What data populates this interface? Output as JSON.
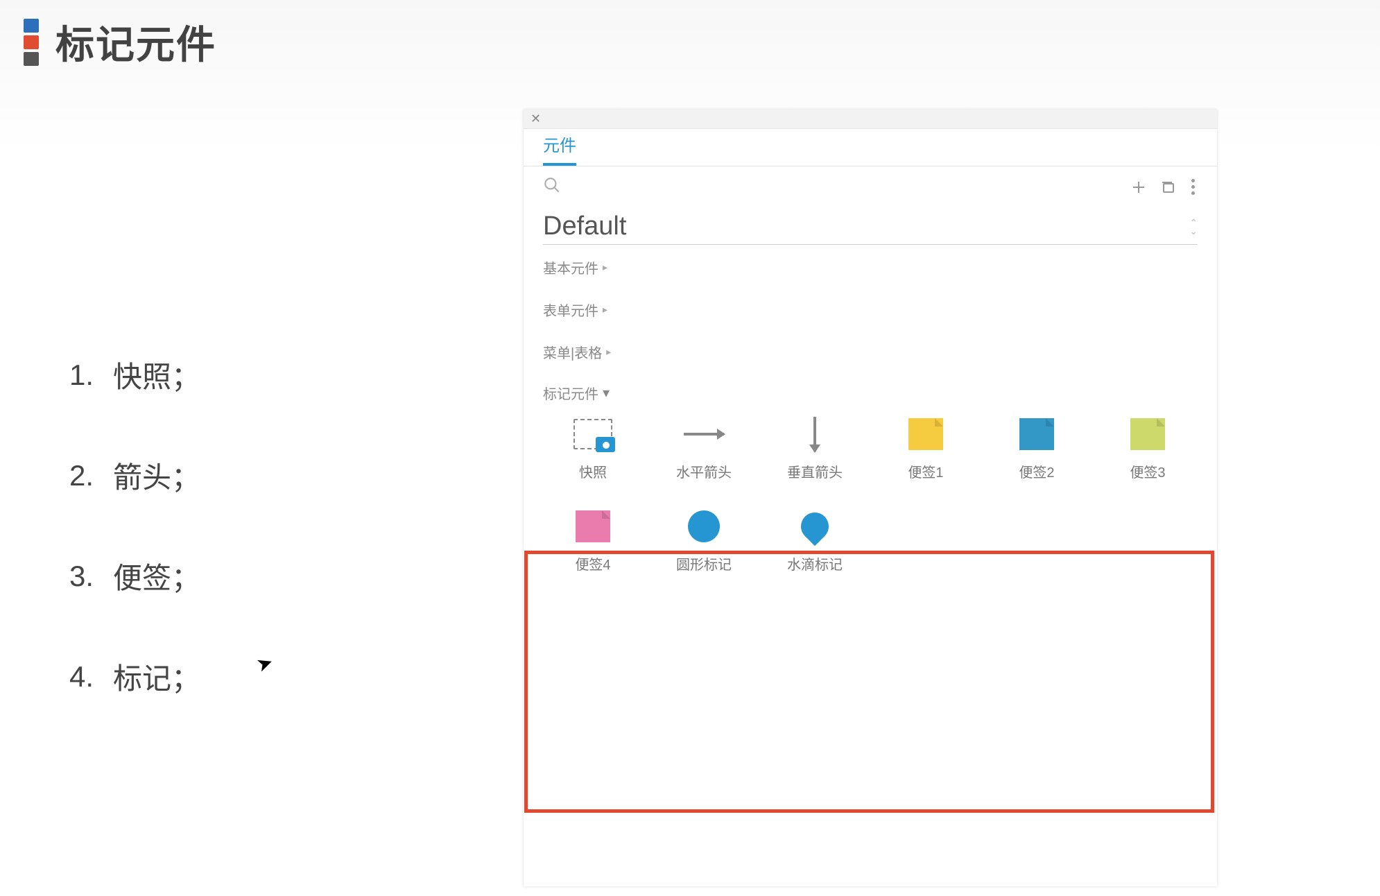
{
  "header": {
    "title": "标记元件"
  },
  "list": {
    "items": [
      {
        "num": "1.",
        "text": "快照；"
      },
      {
        "num": "2.",
        "text": "箭头；"
      },
      {
        "num": "3.",
        "text": "便签；"
      },
      {
        "num": "4.",
        "text": "标记；"
      }
    ]
  },
  "panel": {
    "tab_label": "元件",
    "library": "Default",
    "sections": {
      "basic": "基本元件",
      "form": "表单元件",
      "menu_table": "菜单|表格",
      "markup": "标记元件"
    },
    "widgets": [
      {
        "key": "snapshot",
        "label": "快照"
      },
      {
        "key": "h_arrow",
        "label": "水平箭头"
      },
      {
        "key": "v_arrow",
        "label": "垂直箭头"
      },
      {
        "key": "note1",
        "label": "便签1"
      },
      {
        "key": "note2",
        "label": "便签2"
      },
      {
        "key": "note3",
        "label": "便签3"
      },
      {
        "key": "note4",
        "label": "便签4"
      },
      {
        "key": "circle",
        "label": "圆形标记"
      },
      {
        "key": "drop",
        "label": "水滴标记"
      }
    ]
  },
  "colors": {
    "accent": "#2596d1",
    "highlight_border": "#E0492E",
    "note1": "#f5cb3f",
    "note2": "#3498c7",
    "note3": "#cdd96b",
    "note4": "#e97bad"
  }
}
